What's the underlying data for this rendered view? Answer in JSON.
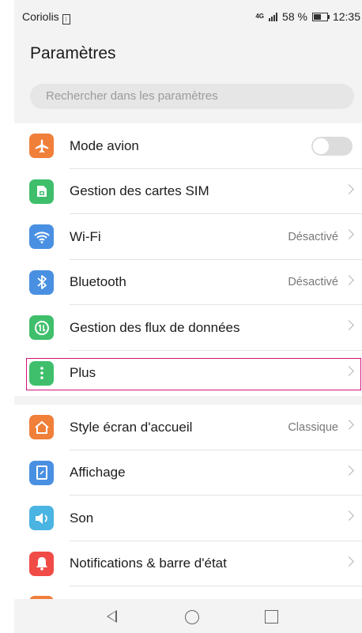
{
  "status_bar": {
    "carrier": "Coriolis",
    "network": "4G",
    "battery": "58 %",
    "time": "12:35"
  },
  "header": {
    "title": "Paramètres"
  },
  "search": {
    "placeholder": "Rechercher dans les paramètres"
  },
  "groups": [
    {
      "items": [
        {
          "label": "Mode avion",
          "icon": "airplane-icon",
          "color": "#f07f3a",
          "toggle": false
        },
        {
          "label": "Gestion des cartes SIM",
          "icon": "sim-card-icon",
          "color": "#3fbf6c"
        },
        {
          "label": "Wi-Fi",
          "icon": "wifi-icon",
          "color": "#4a90e2",
          "value": "Désactivé"
        },
        {
          "label": "Bluetooth",
          "icon": "bluetooth-icon",
          "color": "#4a90e2",
          "value": "Désactivé"
        },
        {
          "label": "Gestion des flux de données",
          "icon": "data-usage-icon",
          "color": "#3fbf6c"
        },
        {
          "label": "Plus",
          "icon": "more-icon",
          "color": "#3fbf6c",
          "highlighted": true
        }
      ]
    },
    {
      "items": [
        {
          "label": "Style écran d'accueil",
          "icon": "home-screen-icon",
          "color": "#f07f3a",
          "value": "Classique"
        },
        {
          "label": "Affichage",
          "icon": "display-icon",
          "color": "#4a90e2"
        },
        {
          "label": "Son",
          "icon": "sound-icon",
          "color": "#4ab4e2"
        },
        {
          "label": "Notifications & barre d'état",
          "icon": "notification-icon",
          "color": "#f04b47"
        }
      ]
    }
  ],
  "highlight_color": "#d2127a",
  "navbar": {
    "back": "back-icon",
    "home": "home-icon",
    "recent": "recent-apps-icon"
  }
}
